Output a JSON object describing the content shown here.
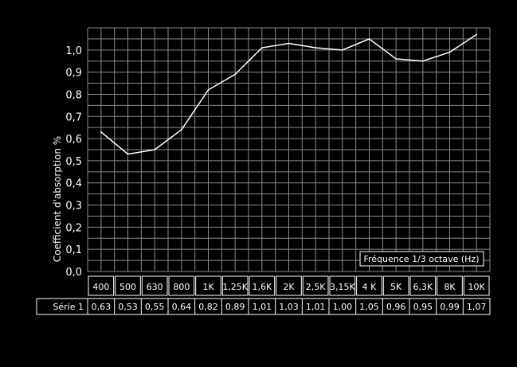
{
  "chart_data": {
    "type": "line",
    "title": "",
    "xlabel": "Fréquence 1/3 octave (Hz)",
    "ylabel": "Coefficient d'absorption %",
    "ylim": [
      0,
      1.1
    ],
    "yticks": [
      "0,0",
      "0,1",
      "0,2",
      "0,3",
      "0,4",
      "0,5",
      "0,6",
      "0,7",
      "0,8",
      "0,9",
      "1,0"
    ],
    "grid": true,
    "categories": [
      "400",
      "500",
      "630",
      "800",
      "1K",
      "1,25K",
      "1,6K",
      "2K",
      "2,5K",
      "3,15K",
      "4 K",
      "5K",
      "6,3K",
      "8K",
      "10K"
    ],
    "series": [
      {
        "name": "Série 1",
        "values": [
          0.63,
          0.53,
          0.55,
          0.64,
          0.82,
          0.89,
          1.01,
          1.03,
          1.01,
          1.0,
          1.05,
          0.96,
          0.95,
          0.99,
          1.07
        ],
        "labels": [
          "0,63",
          "0,53",
          "0,55",
          "0,64",
          "0,82",
          "0,89",
          "1,01",
          "1,03",
          "1,01",
          "1,00",
          "1,05",
          "0,96",
          "0,95",
          "0,99",
          "1,07"
        ]
      }
    ]
  },
  "colors": {
    "background": "#000000",
    "line": "#ffffff",
    "grid": "#8a8a8a"
  }
}
